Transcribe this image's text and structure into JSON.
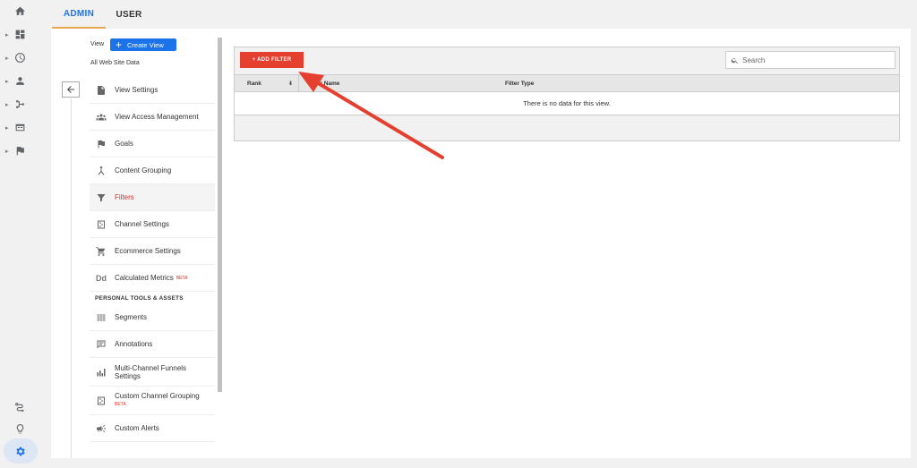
{
  "tabs": {
    "admin": "ADMIN",
    "user": "USER"
  },
  "left_rail": {
    "icons": [
      "home-icon",
      "dashboard-icon",
      "clock-icon",
      "person-icon",
      "acquisition-icon",
      "behavior-icon",
      "flag-icon",
      "attribution-icon",
      "lightbulb-icon",
      "gear-icon"
    ]
  },
  "view": {
    "label": "View",
    "create_label": "Create View",
    "name": "All Web Site Data"
  },
  "menu": {
    "items": [
      {
        "label": "View Settings",
        "icon": "document-icon"
      },
      {
        "label": "View Access Management",
        "icon": "people-icon"
      },
      {
        "label": "Goals",
        "icon": "flag-icon"
      },
      {
        "label": "Content Grouping",
        "icon": "content-grouping-icon"
      },
      {
        "label": "Filters",
        "icon": "filter-icon",
        "active": true
      },
      {
        "label": "Channel Settings",
        "icon": "channel-settings-icon"
      },
      {
        "label": "Ecommerce Settings",
        "icon": "cart-icon"
      },
      {
        "label": "Calculated Metrics",
        "badge": "BETA",
        "icon": "dd-icon"
      }
    ],
    "section_title": "PERSONAL TOOLS & ASSETS",
    "tools": [
      {
        "label": "Segments",
        "icon": "segments-icon"
      },
      {
        "label": "Annotations",
        "icon": "annotation-icon"
      },
      {
        "label": "Multi-Channel Funnels Settings",
        "icon": "bar-chart-icon"
      },
      {
        "label": "Custom Channel Grouping",
        "badge": "BETA",
        "icon": "channel-grouping-icon"
      },
      {
        "label": "Custom Alerts",
        "icon": "megaphone-icon"
      }
    ]
  },
  "filters_table": {
    "add_button": "+ ADD FILTER",
    "search_placeholder": "Search",
    "columns": {
      "rank": "Rank",
      "name": "Filter Name",
      "type": "Filter Type"
    },
    "empty_message": "There is no data for this view."
  },
  "colors": {
    "accent": "#1a73e8",
    "add_button": "#e53f30",
    "arrow": "#e53f30",
    "active_text": "#d93025"
  }
}
